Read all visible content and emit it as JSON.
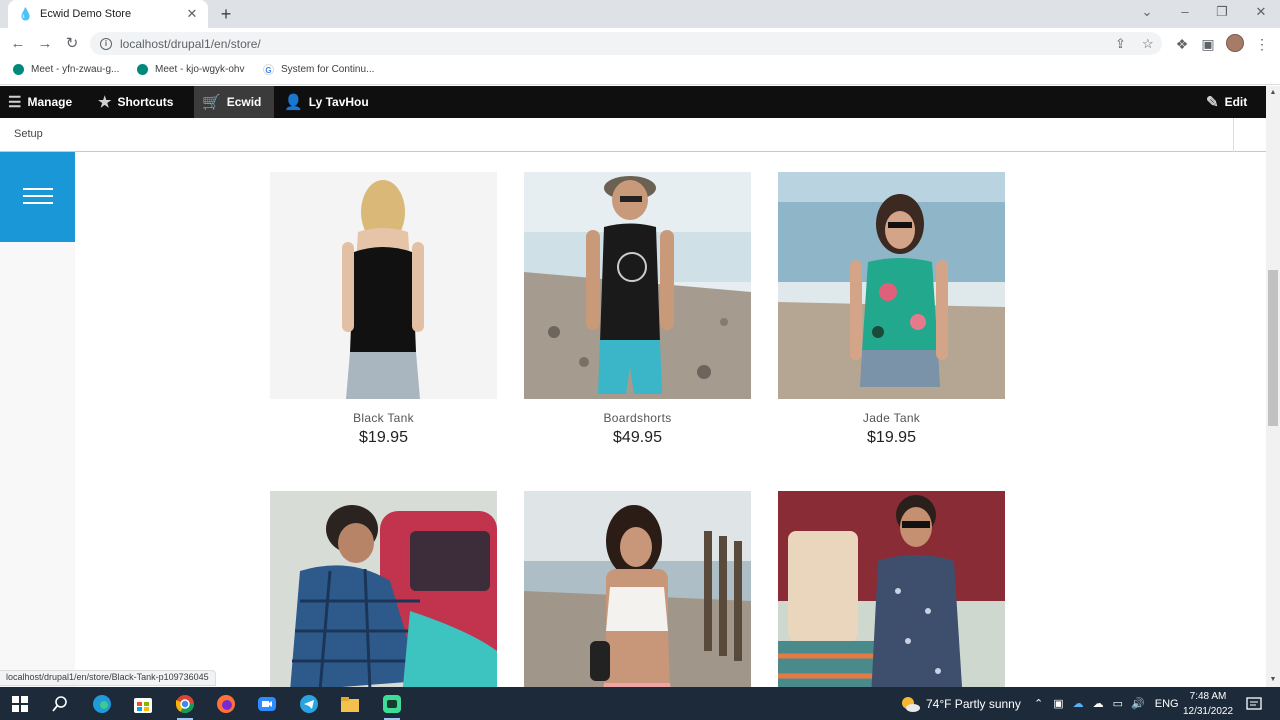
{
  "browser": {
    "tab_title": "Ecwid Demo Store",
    "url": "localhost/drupal1/en/store/",
    "bookmarks": [
      {
        "label": "Meet - yfn-zwau-g...",
        "icon": "meet-icon",
        "color": "#00897b"
      },
      {
        "label": "Meet - kjo-wgyk-ohv",
        "icon": "meet-icon",
        "color": "#00897b"
      },
      {
        "label": "System for Continu...",
        "icon": "google-icon",
        "color": "#4285f4"
      }
    ],
    "status_url": "localhost/drupal1/en/store/Black-Tank-p109736045"
  },
  "admin_toolbar": {
    "manage": "Manage",
    "shortcuts": "Shortcuts",
    "ecwid": "Ecwid",
    "user": "Ly TavHou",
    "edit": "Edit"
  },
  "tray": {
    "setup": "Setup"
  },
  "products": [
    {
      "name": "Black Tank",
      "price": "$19.95",
      "photo": "black-tank-photo"
    },
    {
      "name": "Boardshorts",
      "price": "$49.95",
      "photo": "boardshorts-photo"
    },
    {
      "name": "Jade Tank",
      "price": "$19.95",
      "photo": "jade-tank-photo"
    },
    {
      "name": "",
      "price": "",
      "photo": "plaid-shirt-photo"
    },
    {
      "name": "",
      "price": "",
      "photo": "white-crop-top-photo"
    },
    {
      "name": "",
      "price": "",
      "photo": "printed-shirt-photo"
    }
  ],
  "taskbar": {
    "weather": "74°F  Partly sunny",
    "lang": "ENG",
    "time": "7:48 AM",
    "date": "12/31/2022"
  },
  "colors": {
    "accent": "#1a97d6",
    "admin_bar": "#0f0f0f"
  }
}
